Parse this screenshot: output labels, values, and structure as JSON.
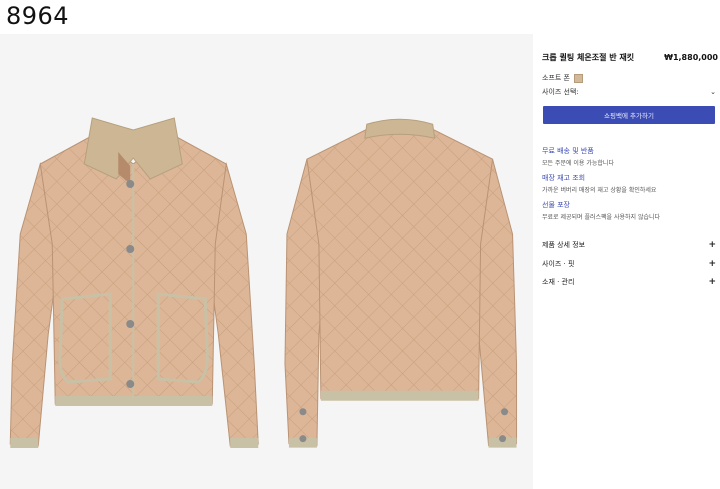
{
  "code_label": "8964",
  "product": {
    "title": "크롭 퀼팅 체온조절 반 재킷",
    "price": "₩1,880,000",
    "color_name": "소프트 폰",
    "swatch_color": "#d4b999",
    "size_label": "사이즈 선택:",
    "cart_button": "쇼핑백에 추가하기"
  },
  "info": [
    {
      "head": "무료 배송 및 반품",
      "sub": "모든 주문에 이용 가능합니다"
    },
    {
      "head": "매장 재고 조회",
      "sub": "가까운 버버리 매장의 재고 상황을 확인하세요"
    },
    {
      "head": "선물 포장",
      "sub": "무료로 제공되며 플러스팩을 사용하지 않습니다"
    }
  ],
  "accordion": [
    {
      "label": "제품 상세 정보",
      "icon": "plus-icon"
    },
    {
      "label": "사이즈 · 핏",
      "icon": "plus-icon"
    },
    {
      "label": "소재 · 관리",
      "icon": "plus-icon"
    }
  ],
  "colors": {
    "jacket": "#dcb697",
    "collar": "#cdb694",
    "trim": "#c9c1a6",
    "accent_button": "#3c4cb5"
  }
}
